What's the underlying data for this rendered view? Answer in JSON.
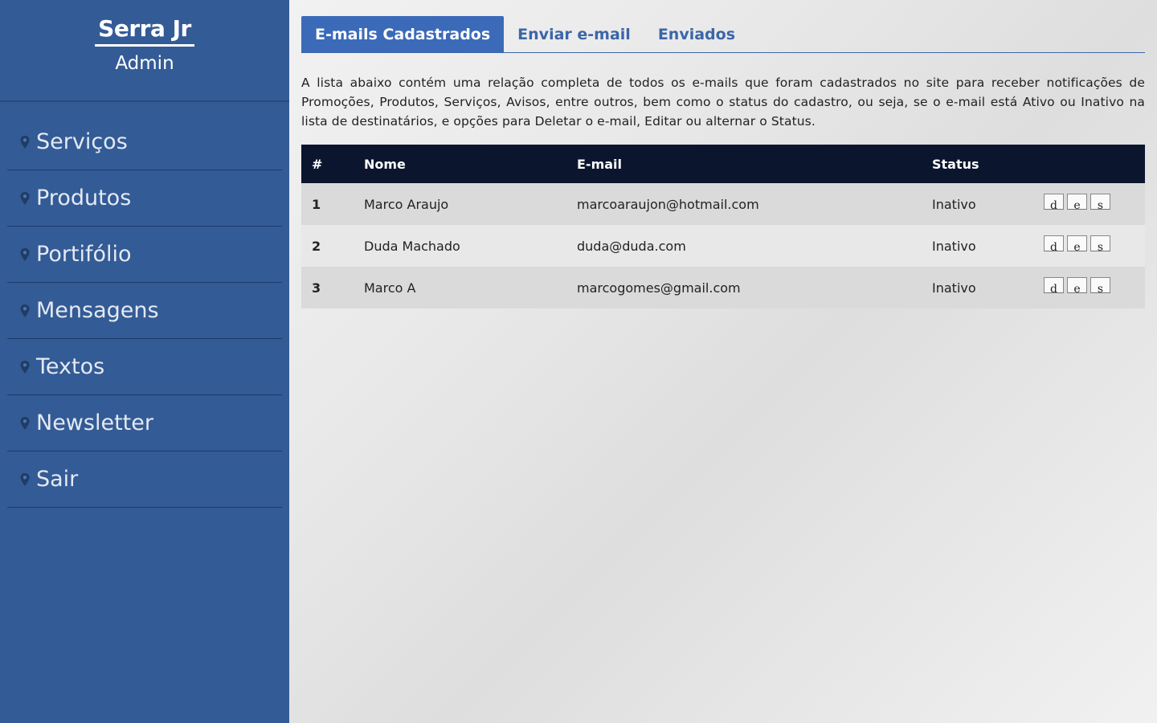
{
  "sidebar": {
    "title": "Serra Jr",
    "subtitle": "Admin",
    "items": [
      {
        "label": "Serviços"
      },
      {
        "label": "Produtos"
      },
      {
        "label": "Portifólio"
      },
      {
        "label": "Mensagens"
      },
      {
        "label": "Textos"
      },
      {
        "label": "Newsletter"
      },
      {
        "label": "Sair"
      }
    ]
  },
  "tabs": [
    {
      "label": "E-mails Cadastrados",
      "active": true
    },
    {
      "label": "Enviar e-mail"
    },
    {
      "label": "Enviados"
    }
  ],
  "intro": "A lista abaixo contém uma relação completa de todos os e-mails que foram cadastrados no site para receber notificações de Promoções, Produtos, Serviços, Avisos, entre outros, bem como o status do cadastro, ou seja, se o e-mail está Ativo ou Inativo na lista de destinatários, e opções para Deletar o e-mail, Editar ou alternar o Status.",
  "table": {
    "headers": {
      "num": "#",
      "name": "Nome",
      "email": "E-mail",
      "status": "Status"
    },
    "rows": [
      {
        "num": "1",
        "name": "Marco Araujo",
        "email": "marcoaraujon@hotmail.com",
        "status": "Inativo"
      },
      {
        "num": "2",
        "name": "Duda Machado",
        "email": "duda@duda.com",
        "status": "Inativo"
      },
      {
        "num": "3",
        "name": "Marco A",
        "email": "marcogomes@gmail.com",
        "status": "Inativo"
      }
    ],
    "actions": {
      "delete": "d",
      "edit": "e",
      "status": "s"
    }
  },
  "colors": {
    "sidebar": "#335b96",
    "tab_active": "#3b6ab8",
    "table_header": "#0b162e"
  }
}
